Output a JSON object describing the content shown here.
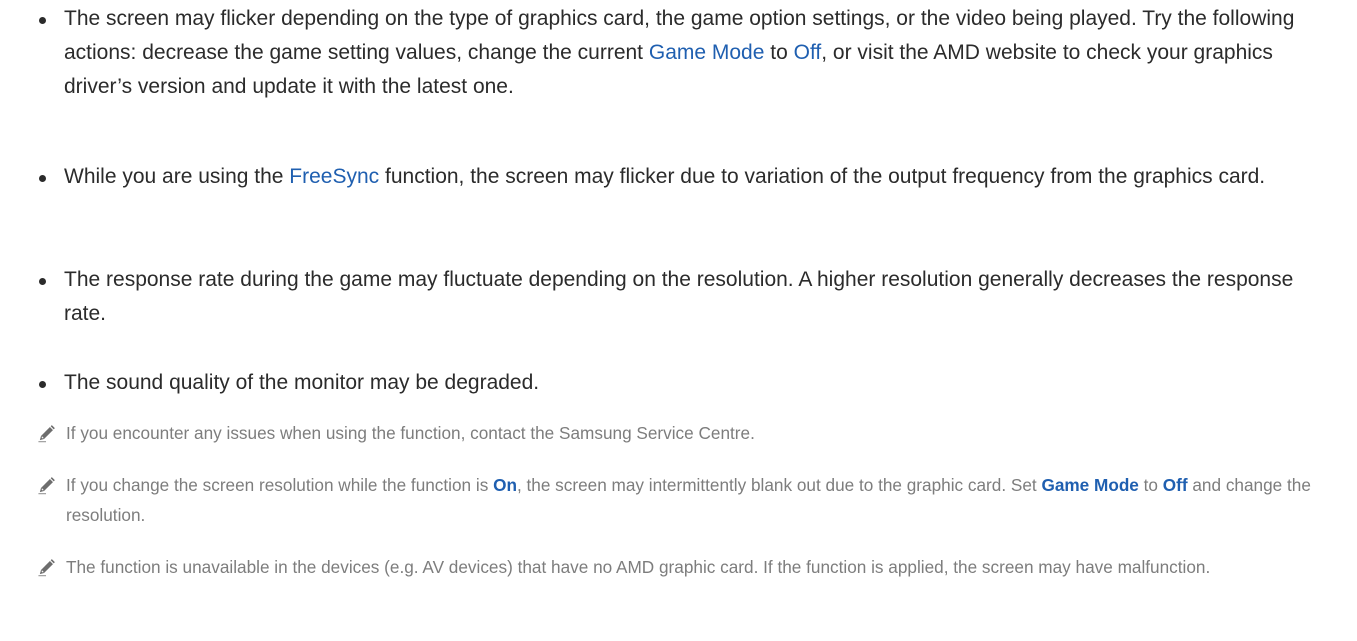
{
  "bullets": [
    {
      "p1": "The screen may flicker depending on the type of graphics card, the game option settings, or the video being played. Try the following actions: decrease the game setting values, change the current ",
      "h1": "Game Mode",
      "p2": " to ",
      "h2": "Off",
      "p3": ", or visit the AMD website to check your graphics driver’s version and update it with the latest one."
    },
    {
      "p1": "While you are using the ",
      "h1": "FreeSync",
      "p2": " function, the screen may flicker due to variation of the output frequency from the graphics card."
    },
    {
      "p1": "The response rate during the game may fluctuate depending on the resolution. A higher resolution generally decreases the response rate."
    },
    {
      "p1": "The sound quality of the monitor may be degraded."
    }
  ],
  "notes": [
    {
      "p1": "If you encounter any issues when using the function, contact the Samsung Service Centre."
    },
    {
      "p1": "If you change the screen resolution while the function is ",
      "h1": "On",
      "p2": ", the screen may intermittently blank out due to the graphic card. Set ",
      "h2": "Game Mode",
      "p3": " to ",
      "h3": "Off",
      "p4": " and change the resolution."
    },
    {
      "p1": "The function is unavailable in the devices (e.g. AV devices) that have no AMD graphic card. If the function is applied, the screen may have malfunction."
    }
  ],
  "icons": {
    "note": "pencil-icon"
  },
  "colors": {
    "body_text": "#2b2b2b",
    "note_text": "#7d7d7d",
    "highlight": "#1f5fb0"
  }
}
